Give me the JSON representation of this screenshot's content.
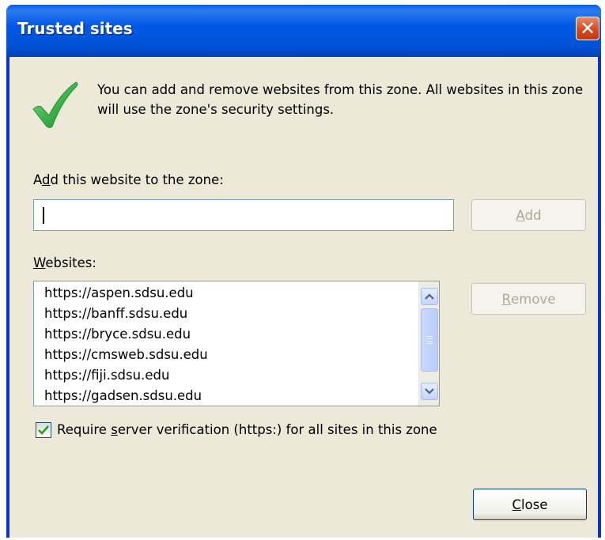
{
  "window": {
    "title": "Trusted sites",
    "close_glyph": "✕"
  },
  "info": {
    "icon": "green-checkmark-icon",
    "text": "You can add and remove websites from this zone. All websites in this zone will use the zone's security settings."
  },
  "add_section": {
    "label_pre": "A",
    "label_accel": "d",
    "label_post": "d this website to the zone:",
    "input_value": "",
    "add_button": {
      "accel": "A",
      "rest": "dd",
      "enabled": false
    }
  },
  "websites": {
    "label_accel": "W",
    "label_rest": "ebsites:",
    "items": [
      "https://aspen.sdsu.edu",
      "https://banff.sdsu.edu",
      "https://bryce.sdsu.edu",
      "https://cmsweb.sdsu.edu",
      "https://fiji.sdsu.edu",
      "https://gadsen.sdsu.edu"
    ],
    "remove_button": {
      "accel": "R",
      "rest": "emove",
      "enabled": false
    }
  },
  "require_https": {
    "checked": true,
    "label_pre": "Require ",
    "label_accel": "s",
    "label_post": "erver verification (https:) for all sites in this zone"
  },
  "close_button": {
    "accel": "C",
    "rest": "lose"
  },
  "colors": {
    "titlebar": "#0058e6",
    "dialog_bg": "#ece9d8",
    "close_x": "#d8471f",
    "check_green": "#3cb64a"
  }
}
